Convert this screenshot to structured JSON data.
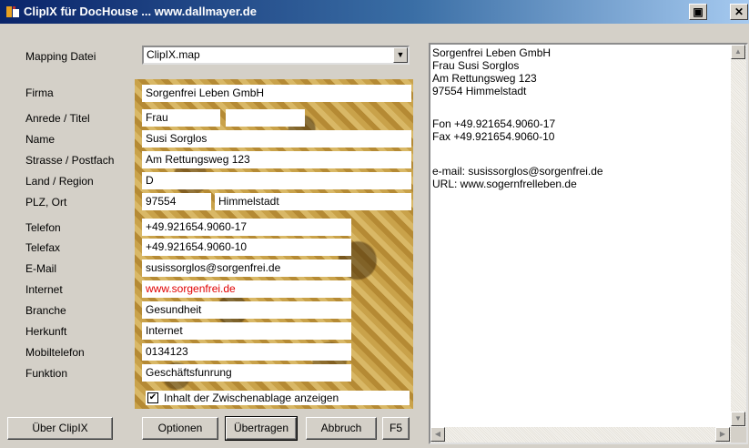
{
  "window": {
    "title": "ClipIX für DocHouse ... www.dallmayer.de",
    "minimize_label": "▣",
    "close_label": "✕"
  },
  "mapping": {
    "label": "Mapping Datei",
    "value": "ClipIX.map",
    "arrow": "▼"
  },
  "labels": {
    "firma": "Firma",
    "anrede": "Anrede / Titel",
    "name": "Name",
    "strasse": "Strasse / Postfach",
    "land": "Land / Region",
    "plz": "PLZ, Ort",
    "telefon": "Telefon",
    "telefax": "Telefax",
    "email": "E-Mail",
    "internet": "Internet",
    "branche": "Branche",
    "herkunft": "Herkunft",
    "mobil": "Mobiltelefon",
    "funktion": "Funktion"
  },
  "fields": {
    "firma": "Sorgenfrei Leben GmbH",
    "anrede": "Frau",
    "titel": "",
    "name": "Susi Sorglos",
    "strasse": "Am Rettungsweg 123",
    "land": "D",
    "plz": "97554",
    "ort": "Himmelstadt",
    "telefon": "+49.921654.9060-17",
    "telefax": "+49.921654.9060-10",
    "email": "susissorglos@sorgenfrei.de",
    "internet": "www.sorgenfrei.de",
    "branche": "Gesundheit",
    "herkunft": "Internet",
    "mobil": "0134123",
    "funktion": "Geschäftsfunrung"
  },
  "checkbox": {
    "label": "Inhalt der Zwischenablage anzeigen",
    "checked": true,
    "mark": "✔"
  },
  "buttons": {
    "ueber": "Über ClipIX",
    "optionen": "Optionen",
    "uebertragen": "Übertragen",
    "abbruch": "Abbruch",
    "f5": "F5"
  },
  "clipboard": {
    "lines": [
      "Sorgenfrei Leben GmbH",
      "Frau Susi Sorglos",
      "Am Rettungsweg 123",
      "97554 Himmelstadt",
      "",
      "Fon +49.921654.9060-17",
      "Fax +49.921654.9060-10",
      "",
      "e-mail: susissorglos@sorgenfrei.de",
      "URL: www.sogernfrelleben.de"
    ]
  },
  "scroll": {
    "up": "▲",
    "down": "▼",
    "left": "◀",
    "right": "▶"
  }
}
